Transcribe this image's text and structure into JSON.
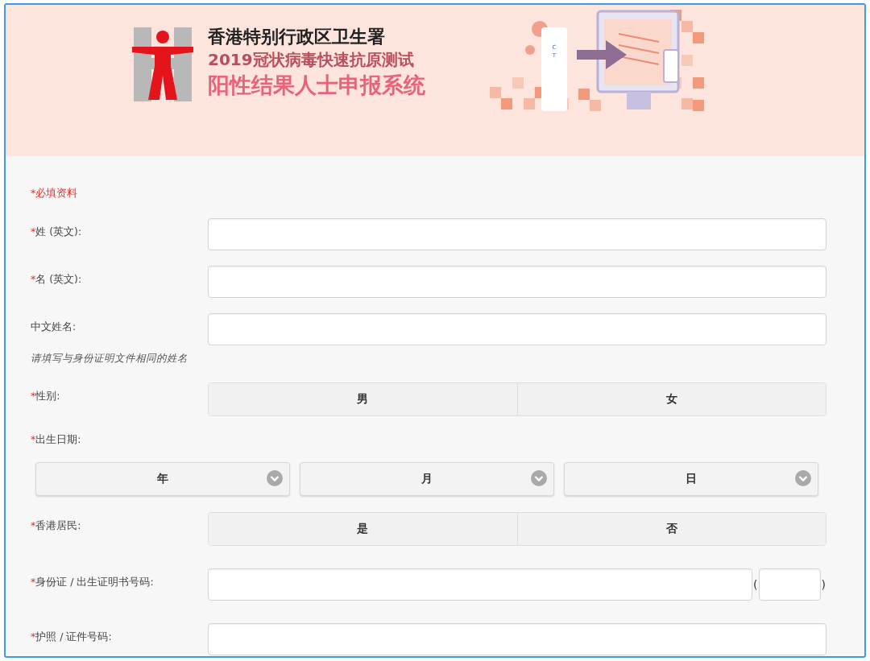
{
  "banner": {
    "department": "香港特别行政区卫生署",
    "subtitle": "2019冠状病毒快速抗原测试",
    "title": "阳性结果人士申报系统",
    "test_kit_labels": [
      "C",
      "T"
    ]
  },
  "form": {
    "required_note": {
      "mark": "*",
      "text": "必填资料"
    },
    "rows": [
      {
        "kind": "text",
        "required_mark": "*",
        "label": "姓 (英文):"
      },
      {
        "kind": "text",
        "required_mark": "*",
        "label": "名 (英文):"
      },
      {
        "kind": "text",
        "label": "中文姓名:",
        "hint": "请填写与身份证明文件相同的姓名"
      },
      {
        "kind": "toggle",
        "required_mark": "*",
        "label": "性别:",
        "options": [
          {
            "label": "男",
            "selected": false
          },
          {
            "label": "女",
            "selected": false
          }
        ]
      },
      {
        "kind": "date",
        "required_mark": "*",
        "label": "出生日期:",
        "selects": [
          {
            "value": "年"
          },
          {
            "value": "月"
          },
          {
            "value": "日"
          }
        ]
      },
      {
        "kind": "toggle",
        "required_mark": "*",
        "label": "香港居民:",
        "options": [
          {
            "label": "是",
            "selected": false
          },
          {
            "label": "否",
            "selected": false
          }
        ]
      },
      {
        "kind": "id",
        "required_mark": "*",
        "label": "身份证 / 出生证明书号码:",
        "open_paren": "(",
        "close_paren": ")"
      },
      {
        "kind": "text",
        "required_mark": "*",
        "label": "护照 / 证件号码:"
      }
    ]
  }
}
